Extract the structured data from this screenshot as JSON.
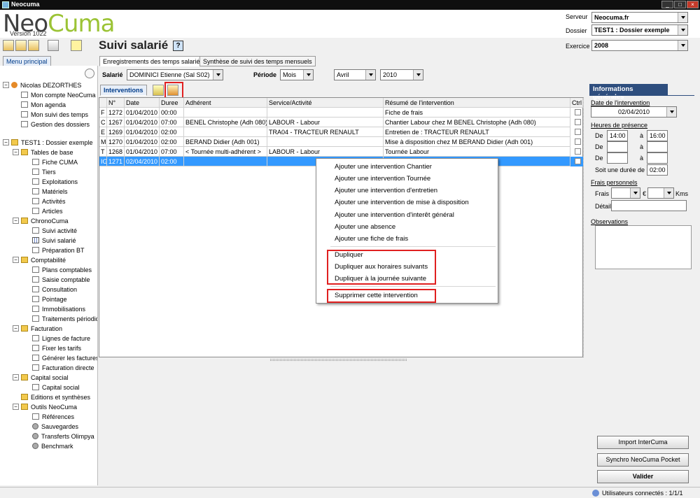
{
  "window": {
    "title": "Neocuma"
  },
  "header": {
    "logo_part1": "Neo",
    "logo_part2": "Cuma",
    "version": "Version 1022",
    "serveur_label": "Serveur",
    "serveur_value": "Neocuma.fr",
    "dossier_label": "Dossier",
    "dossier_value": "TEST1 : Dossier exemple",
    "exercice_label": "Exercice",
    "exercice_value": "2008"
  },
  "page": {
    "title": "Suivi salarié"
  },
  "tabs": {
    "menu": "Menu principal",
    "enregistrements": "Enregistrements des temps salariés",
    "synthese": "Synthèse de suivi des temps mensuels"
  },
  "filters": {
    "salarie_label": "Salarié",
    "salarie_value": "DOMINICI Etienne (Sal S02)",
    "periode_label": "Période",
    "periode_value": "Mois",
    "mois_value": "Avril",
    "annee_value": "2010"
  },
  "interventions_tab": "Interventions",
  "grid": {
    "columns": [
      "N°",
      "Date",
      "Duree",
      "Adhérent",
      "Service/Activité",
      "Résumé de l'intervention",
      "Ctrl"
    ],
    "rows": [
      {
        "type": "F",
        "num": "1272",
        "date": "01/04/2010",
        "duree": "00:00",
        "adherent": "",
        "service": "",
        "resume": "Fiche de frais"
      },
      {
        "type": "C",
        "num": "1267",
        "date": "01/04/2010",
        "duree": "07:00",
        "adherent": "BENEL Christophe (Adh 080)",
        "service": "LABOUR - Labour",
        "resume": "Chantier Labour chez M BENEL Christophe (Adh 080)"
      },
      {
        "type": "E",
        "num": "1269",
        "date": "01/04/2010",
        "duree": "02:00",
        "adherent": "",
        "service": "TRA04 - TRACTEUR RENAULT",
        "resume": "Entretien de : TRACTEUR RENAULT"
      },
      {
        "type": "M",
        "num": "1270",
        "date": "01/04/2010",
        "duree": "02:00",
        "adherent": "BERAND Didier (Adh 001)",
        "service": "",
        "resume": "Mise à disposition chez M BERAND Didier (Adh 001)"
      },
      {
        "type": "T",
        "num": "1268",
        "date": "01/04/2010",
        "duree": "07:00",
        "adherent": "< Tournée multi-adhérent >",
        "service": "LABOUR - Labour",
        "resume": "Tournée Labour"
      },
      {
        "type": "IG",
        "num": "1271",
        "date": "02/04/2010",
        "duree": "02:00",
        "adherent": "",
        "service": "",
        "resume": ""
      }
    ]
  },
  "context_menu": {
    "items": [
      "Ajouter une intervention Chantier",
      "Ajouter une intervention Tournée",
      "Ajouter une intervention d'entretien",
      "Ajouter une intervention de mise à disposition",
      "Ajouter une intervention d'interêt général",
      "Ajouter une absence",
      "Ajouter une fiche de frais",
      "Dupliquer",
      "Dupliquer aux horaires suivants",
      "Dupliquer à la journée suivante",
      "Supprimer cette intervention"
    ]
  },
  "sidebar": {
    "user": "Nicolas DEZORTHES",
    "user_items": [
      "Mon compte NeoCuma",
      "Mon agenda",
      "Mon suivi des temps",
      "Gestion des dossiers"
    ],
    "dossier": "TEST1 : Dossier exemple",
    "groups": [
      {
        "label": "Tables de base",
        "items": [
          "Fiche CUMA",
          "Tiers",
          "Exploitations",
          "Matériels",
          "Activités",
          "Articles"
        ]
      },
      {
        "label": "ChronoCuma",
        "items": [
          "Suivi activité",
          "Suivi salarié",
          "Préparation BT"
        ]
      },
      {
        "label": "Comptabilité",
        "items": [
          "Plans comptables",
          "Saisie comptable",
          "Consultation",
          "Pointage",
          "Immobilisations",
          "Traitements périodiques"
        ]
      },
      {
        "label": "Facturation",
        "items": [
          "Lignes de facture",
          "Fixer les tarifs",
          "Générer les factures",
          "Facturation directe"
        ]
      },
      {
        "label": "Capital social",
        "items": [
          "Capital social"
        ]
      },
      {
        "label": "Editions et synthèses",
        "items": []
      },
      {
        "label": "Outils NeoCuma",
        "items": [
          "Références",
          "Sauvegardes",
          "Transferts Olimpya",
          "Benchmark"
        ]
      }
    ]
  },
  "info": {
    "title": "Informations générales",
    "date_label": "Date de l'intervention",
    "date_value": "02/04/2010",
    "heures_label": "Heures de présence",
    "de": "De",
    "a": "à",
    "h1_start": "14:00",
    "h1_end": "16:00",
    "soit_label": "Soit une durée",
    "de2": "de",
    "duree_value": "02:00",
    "frais_section": "Frais personnels",
    "frais_label": "Frais",
    "euro": "€",
    "kms": "Kms",
    "detail_label": "Détail",
    "observations_label": "Observations"
  },
  "buttons": {
    "import": "Import InterCuma",
    "synchro": "Synchro NeoCuma Pocket",
    "valider": "Valider"
  },
  "status": {
    "users": "Utilisateurs connectés : 1/1/1"
  },
  "colors": {
    "accent": "#2e4e7e",
    "selection": "#3399ff",
    "highlight_box": "#e02020"
  }
}
